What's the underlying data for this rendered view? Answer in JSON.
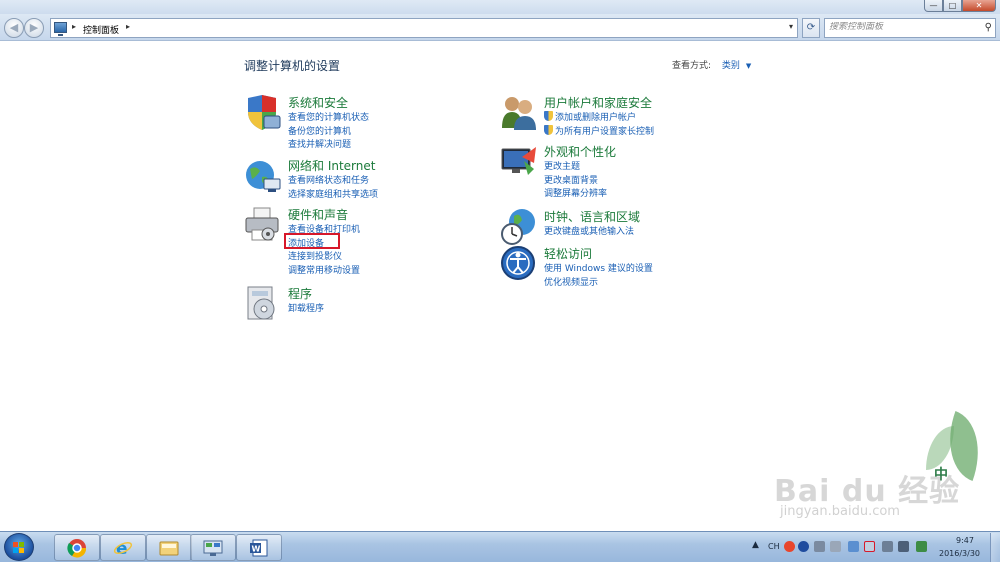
{
  "window": {
    "minimize": "—",
    "maximize": "□",
    "close": "✕"
  },
  "nav": {
    "back": "◀",
    "forward": "▶",
    "breadcrumb": "控制面板",
    "search_placeholder": "搜索控制面板"
  },
  "content": {
    "heading": "调整计算机的设置",
    "view_by_label": "查看方式:",
    "view_by_value": "类别"
  },
  "categories": {
    "system": {
      "title": "系统和安全",
      "links": [
        "查看您的计算机状态",
        "备份您的计算机",
        "查找并解决问题"
      ]
    },
    "network": {
      "title": "网络和 Internet",
      "links": [
        "查看网络状态和任务",
        "选择家庭组和共享选项"
      ]
    },
    "hardware": {
      "title": "硬件和声音",
      "links": [
        "查看设备和打印机",
        "添加设备",
        "连接到投影仪",
        "调整常用移动设置"
      ]
    },
    "programs": {
      "title": "程序",
      "links": [
        "卸载程序"
      ]
    },
    "users": {
      "title": "用户帐户和家庭安全",
      "links": [
        "添加或删除用户帐户",
        "为所有用户设置家长控制"
      ]
    },
    "appearance": {
      "title": "外观和个性化",
      "links": [
        "更改主题",
        "更改桌面背景",
        "调整屏幕分辨率"
      ]
    },
    "clock": {
      "title": "时钟、语言和区域",
      "links": [
        "更改键盘或其他输入法"
      ]
    },
    "ease": {
      "title": "轻松访问",
      "links": [
        "使用 Windows 建议的设置",
        "优化视频显示"
      ]
    }
  },
  "watermark": {
    "brand": "Bai du 经验",
    "url": "jingyan.baidu.com",
    "badge": "中"
  },
  "taskbar": {
    "lang": "CH",
    "time": "9:47",
    "date": "2016/3/30"
  },
  "colors": {
    "category_title": "#1b7a3a",
    "link": "#1a5fb4",
    "highlight": "#d7182a"
  }
}
